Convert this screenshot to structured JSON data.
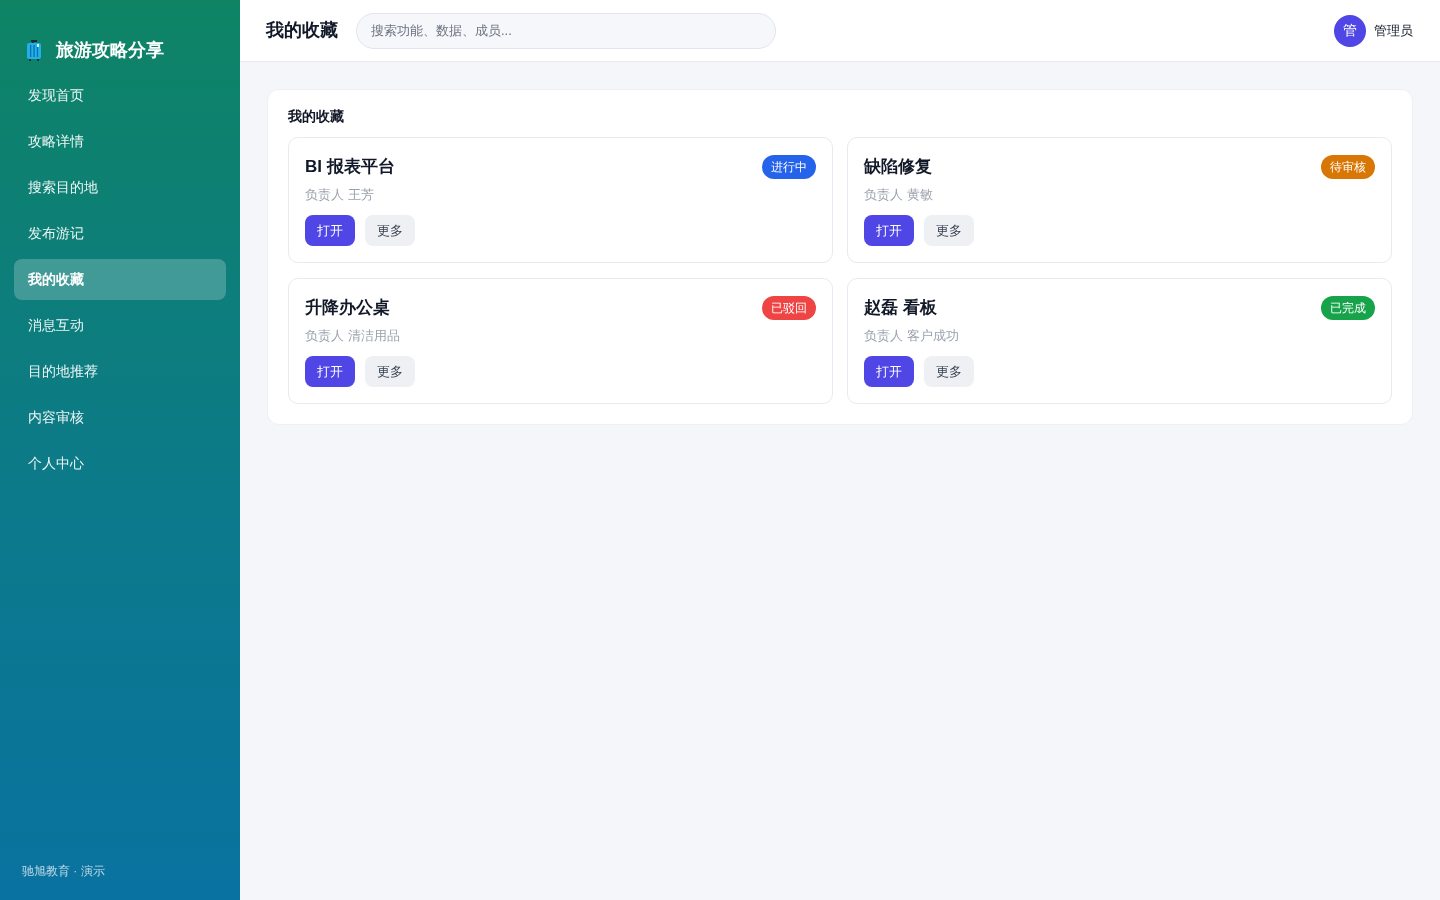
{
  "sidebar": {
    "brand": "旅游攻略分享",
    "items": [
      {
        "label": "发现首页",
        "selected": false
      },
      {
        "label": "攻略详情",
        "selected": false
      },
      {
        "label": "搜索目的地",
        "selected": false
      },
      {
        "label": "发布游记",
        "selected": false
      },
      {
        "label": "我的收藏",
        "selected": true
      },
      {
        "label": "消息互动",
        "selected": false
      },
      {
        "label": "目的地推荐",
        "selected": false
      },
      {
        "label": "内容审核",
        "selected": false
      },
      {
        "label": "个人中心",
        "selected": false
      }
    ],
    "footer": "驰旭教育 · 演示"
  },
  "header": {
    "title": "我的收藏",
    "search": {
      "placeholder": "搜索功能、数据、成员..."
    },
    "user": {
      "avatar": "管",
      "name": "管理员"
    }
  },
  "panel": {
    "title": "我的收藏",
    "items": [
      {
        "title": "BI 报表平台",
        "status": "进行中",
        "color": "#2563eb",
        "owner": "负责人 王芳",
        "actions": [
          {
            "label": "打开",
            "kind": "primary"
          },
          {
            "label": "更多",
            "kind": "secondary"
          }
        ]
      },
      {
        "title": "缺陷修复",
        "status": "待审核",
        "color": "#d97706",
        "owner": "负责人 黄敏",
        "actions": [
          {
            "label": "打开",
            "kind": "primary"
          },
          {
            "label": "更多",
            "kind": "secondary"
          }
        ]
      },
      {
        "title": "升降办公桌",
        "status": "已驳回",
        "color": "#ef4444",
        "owner": "负责人 清洁用品",
        "actions": [
          {
            "label": "打开",
            "kind": "primary"
          },
          {
            "label": "更多",
            "kind": "secondary"
          }
        ]
      },
      {
        "title": "赵磊 看板",
        "status": "已完成",
        "color": "#16a34a",
        "owner": "负责人 客户成功",
        "actions": [
          {
            "label": "打开",
            "kind": "primary"
          },
          {
            "label": "更多",
            "kind": "secondary"
          }
        ]
      }
    ]
  }
}
